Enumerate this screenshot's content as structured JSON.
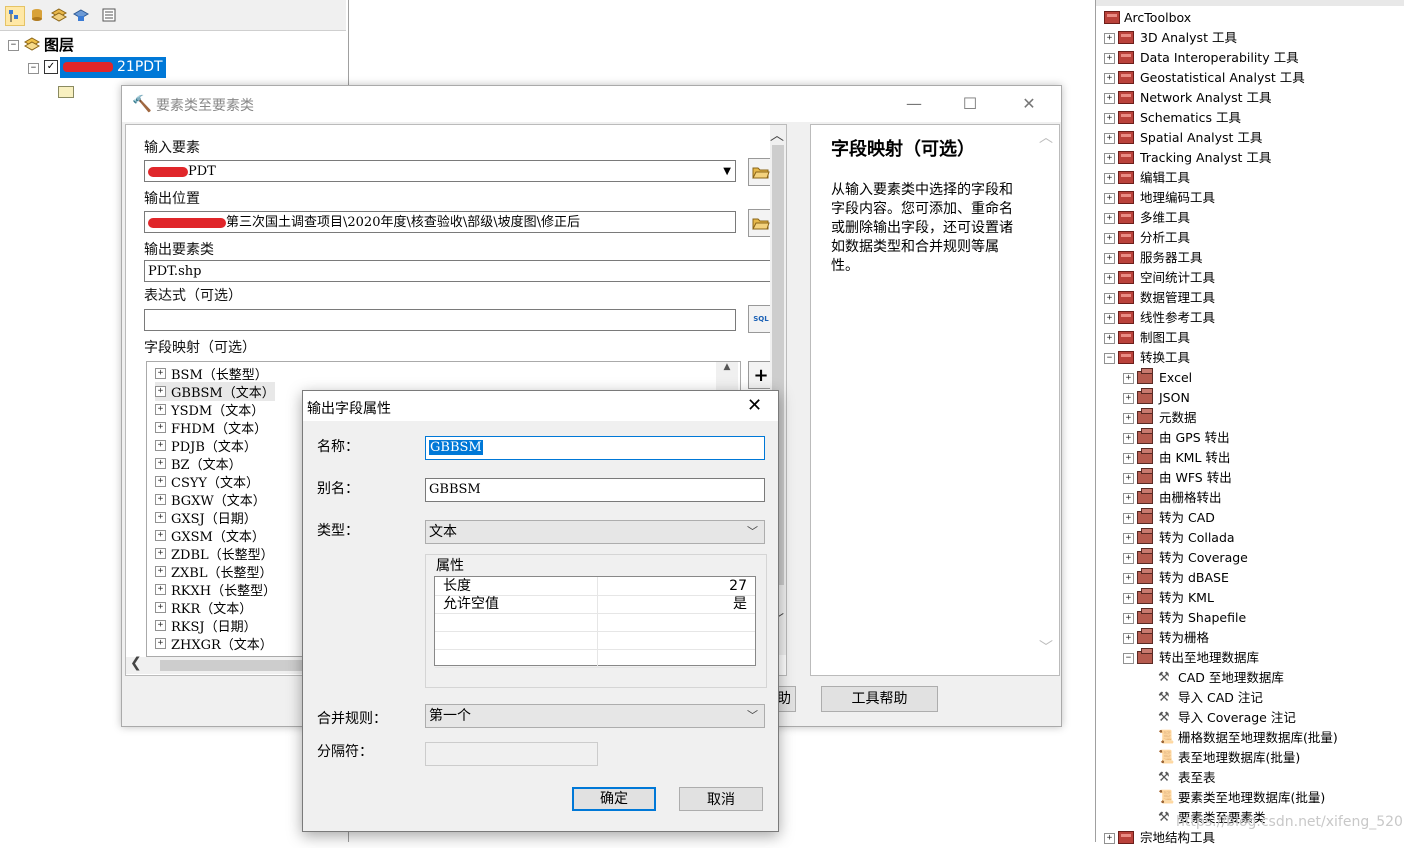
{
  "toc": {
    "layers_label": "图层",
    "layer_name": "21PDT"
  },
  "tool_dialog": {
    "title": "要素类至要素类",
    "input_features_label": "输入要素",
    "input_features_value": "PDT",
    "output_location_label": "输出位置",
    "output_location_value": "第三次国土调查项目\\2020年度\\核查验收\\部级\\坡度图\\修正后",
    "output_feature_class_label": "输出要素类",
    "output_feature_class_value": "PDT.shp",
    "expression_label": "表达式（可选）",
    "expression_value": "",
    "field_map_label": "字段映射（可选）",
    "field_map_items": [
      "BSM（长整型）",
      "GBBSM（文本）",
      "YSDM（文本）",
      "FHDM（文本）",
      "PDJB（文本）",
      "BZ（文本）",
      "CSYY（文本）",
      "BGXW（文本）",
      "GXSJ（日期）",
      "GXSM（文本）",
      "ZDBL（长整型）",
      "ZXBL（长整型）",
      "RKXH（长整型）",
      "RKR（文本）",
      "RKSJ（日期）",
      "ZHXGR（文本）"
    ],
    "sql_icon_text": "SQL",
    "ok_partial": "助",
    "tool_help_button": "工具帮助"
  },
  "help_panel": {
    "title": "字段映射（可选）",
    "body": "从输入要素类中选择的字段和字段内容。您可添加、重命名或删除输出字段，还可设置诸如数据类型和合并规则等属性。"
  },
  "field_dialog": {
    "title": "输出字段属性",
    "name_label": "名称：",
    "name_value": "GBBSM",
    "alias_label": "别名：",
    "alias_value": "GBBSM",
    "type_label": "类型：",
    "type_value": "文本",
    "properties_group": "属性",
    "properties": [
      {
        "key": "长度",
        "value": "27"
      },
      {
        "key": "允许空值",
        "value": "是"
      }
    ],
    "merge_rule_label": "合并规则：",
    "merge_rule_value": "第一个",
    "delimiter_label": "分隔符：",
    "delimiter_value": "",
    "ok_button": "确定",
    "cancel_button": "取消"
  },
  "toolbox": {
    "root": "ArcToolbox",
    "toolboxes": [
      "3D Analyst 工具",
      "Data Interoperability 工具",
      "Geostatistical Analyst 工具",
      "Network Analyst 工具",
      "Schematics 工具",
      "Spatial Analyst 工具",
      "Tracking Analyst 工具",
      "编辑工具",
      "地理编码工具",
      "多维工具",
      "分析工具",
      "服务器工具",
      "空间统计工具",
      "数据管理工具",
      "线性参考工具",
      "制图工具"
    ],
    "conversion": "转换工具",
    "conversion_toolsets": [
      "Excel",
      "JSON",
      "元数据",
      "由 GPS 转出",
      "由 KML 转出",
      "由 WFS 转出",
      "由栅格转出",
      "转为 CAD",
      "转为 Collada",
      "转为 Coverage",
      "转为 dBASE",
      "转为 KML",
      "转为 Shapefile",
      "转为栅格"
    ],
    "to_geodatabase": "转出至地理数据库",
    "gdb_tools": [
      {
        "label": "CAD 至地理数据库",
        "kind": "hammer"
      },
      {
        "label": "导入 CAD 注记",
        "kind": "hammer"
      },
      {
        "label": "导入 Coverage 注记",
        "kind": "hammer"
      },
      {
        "label": "栅格数据至地理数据库(批量)",
        "kind": "script"
      },
      {
        "label": "表至地理数据库(批量)",
        "kind": "script"
      },
      {
        "label": "表至表",
        "kind": "hammer"
      },
      {
        "label": "要素类至地理数据库(批量)",
        "kind": "script"
      },
      {
        "label": "要素类至要素类",
        "kind": "hammer"
      }
    ],
    "last_item": "宗地结构工具"
  },
  "watermark": "https://blog.csdn.net/xifeng_520"
}
